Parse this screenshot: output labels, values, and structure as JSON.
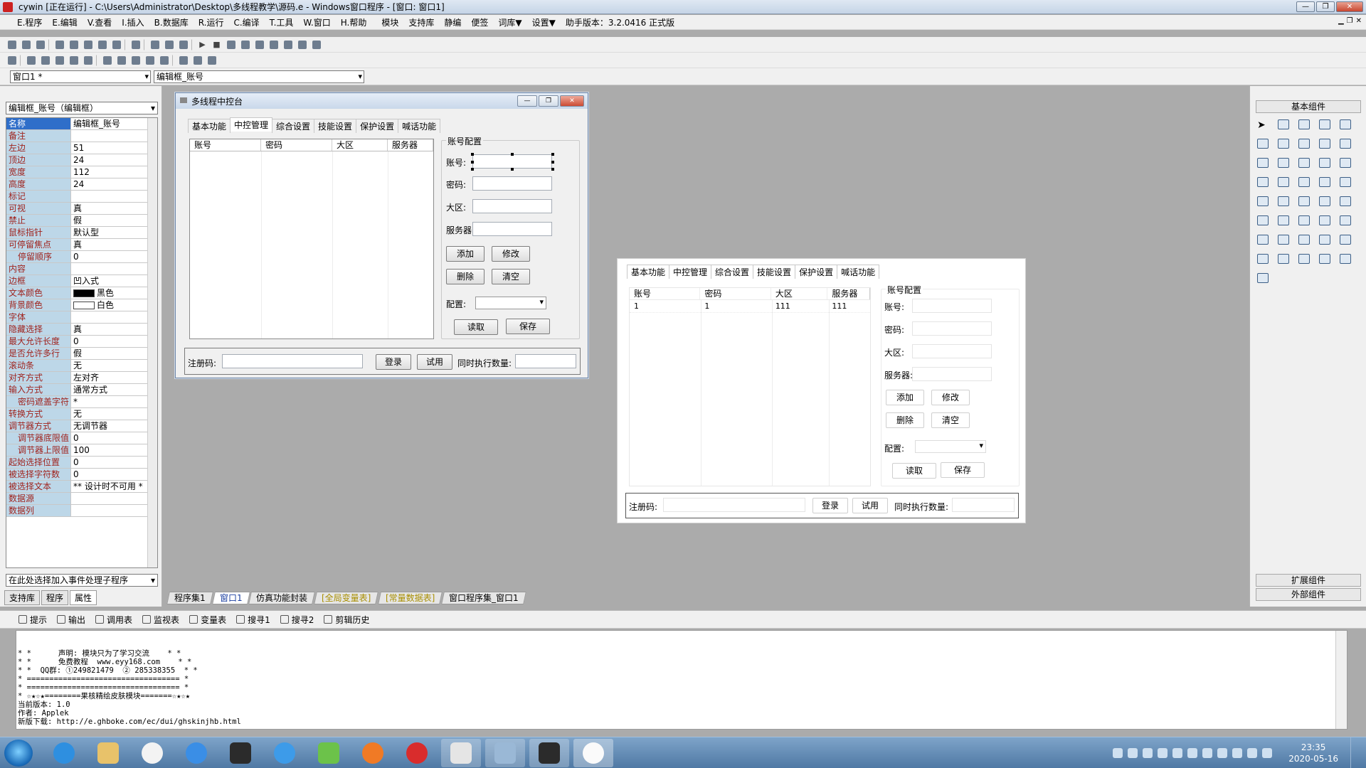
{
  "window": {
    "title": "cywin [正在运行] - C:\\Users\\Administrator\\Desktop\\多线程教学\\源码.e - Windows窗口程序 - [窗口: 窗口1]",
    "controls": [
      "—",
      "❐",
      "✕"
    ]
  },
  "menu": {
    "items": [
      "E.程序",
      "E.编辑",
      "V.查看",
      "I.插入",
      "B.数据库",
      "R.运行",
      "C.编译",
      "T.工具",
      "W.窗口",
      "H.帮助",
      "模块",
      "支持库",
      "静编",
      "便签",
      "词库▼",
      "设置▼"
    ],
    "version": "助手版本：3.2.0416 正式版"
  },
  "selectors": {
    "window_combo": "窗口1 *",
    "control_combo": "编辑框_账号"
  },
  "properties": {
    "object_combo": "编辑框_账号（编辑框）",
    "rows": [
      {
        "k": "名称",
        "v": "编辑框_账号",
        "sel": true
      },
      {
        "k": "备注",
        "v": ""
      },
      {
        "k": "左边",
        "v": "51"
      },
      {
        "k": "顶边",
        "v": "24"
      },
      {
        "k": "宽度",
        "v": "112"
      },
      {
        "k": "高度",
        "v": "24"
      },
      {
        "k": "标记",
        "v": ""
      },
      {
        "k": "可视",
        "v": "真"
      },
      {
        "k": "禁止",
        "v": "假"
      },
      {
        "k": "鼠标指针",
        "v": "默认型"
      },
      {
        "k": "可停留焦点",
        "v": "真"
      },
      {
        "k": "停留顺序",
        "v": "0",
        "sub": true
      },
      {
        "k": "内容",
        "v": ""
      },
      {
        "k": "边框",
        "v": "凹入式"
      },
      {
        "k": "文本颜色",
        "v": "黑色",
        "swatch": "#000000"
      },
      {
        "k": "背景颜色",
        "v": "白色",
        "swatch": "#ffffff"
      },
      {
        "k": "字体",
        "v": ""
      },
      {
        "k": "隐藏选择",
        "v": "真"
      },
      {
        "k": "最大允许长度",
        "v": "0"
      },
      {
        "k": "是否允许多行",
        "v": "假"
      },
      {
        "k": "滚动条",
        "v": "无"
      },
      {
        "k": "对齐方式",
        "v": "左对齐"
      },
      {
        "k": "输入方式",
        "v": "通常方式"
      },
      {
        "k": "密码遮盖字符",
        "v": "*",
        "sub": true
      },
      {
        "k": "转换方式",
        "v": "无"
      },
      {
        "k": "调节器方式",
        "v": "无调节器"
      },
      {
        "k": "调节器底限值",
        "v": "0",
        "sub": true
      },
      {
        "k": "调节器上限值",
        "v": "100",
        "sub": true
      },
      {
        "k": "起始选择位置",
        "v": "0"
      },
      {
        "k": "被选择字符数",
        "v": "0"
      },
      {
        "k": "被选择文本",
        "v": "** 设计时不可用 *"
      },
      {
        "k": "数据源",
        "v": ""
      },
      {
        "k": "数据列",
        "v": ""
      }
    ],
    "event_combo": "在此处选择加入事件处理子程序",
    "tabs": [
      "支持库",
      "程序",
      "属性"
    ]
  },
  "designer": {
    "title": "多线程中控台",
    "tabs": [
      "基本功能",
      "中控管理",
      "综合设置",
      "技能设置",
      "保护设置",
      "喊话功能"
    ],
    "columns": [
      "账号",
      "密码",
      "大区",
      "服务器"
    ],
    "group_title": "账号配置",
    "labels": {
      "account": "账号:",
      "password": "密码:",
      "region": "大区:",
      "server": "服务器:",
      "config": "配置:"
    },
    "buttons": {
      "add": "添加",
      "edit": "修改",
      "delete": "删除",
      "clear": "清空",
      "read": "读取",
      "save": "保存"
    },
    "footer": {
      "reg_label": "注册码:",
      "login": "登录",
      "trial": "试用",
      "concurrent_label": "同时执行数量:"
    }
  },
  "runtime": {
    "tabs": [
      "基本功能",
      "中控管理",
      "综合设置",
      "技能设置",
      "保护设置",
      "喊话功能"
    ],
    "columns": [
      "账号",
      "密码",
      "大区",
      "服务器"
    ],
    "rows": [
      [
        "1",
        "1",
        "111",
        "111"
      ]
    ],
    "group_title": "账号配置",
    "labels": {
      "account": "账号:",
      "password": "密码:",
      "region": "大区:",
      "server": "服务器:",
      "config": "配置:"
    },
    "buttons": {
      "add": "添加",
      "edit": "修改",
      "delete": "删除",
      "clear": "清空",
      "read": "读取",
      "save": "保存"
    },
    "footer": {
      "reg_label": "注册码:",
      "login": "登录",
      "trial": "试用",
      "concurrent_label": "同时执行数量:"
    }
  },
  "components": {
    "header": "基本组件",
    "ext": "扩展组件",
    "outer": "外部组件"
  },
  "doc_tabs": [
    "程序集1",
    "窗口1",
    "仿真功能封装",
    "[全局变量表]",
    "[常量数据表]",
    "窗口程序集_窗口1"
  ],
  "output_tabs": [
    "提示",
    "输出",
    "调用表",
    "监视表",
    "变量表",
    "搜寻1",
    "搜寻2",
    "剪辑历史"
  ],
  "output_text": "* *      声明: 模块只为了学习交流    * *\n* *      免费教程  www.eyy168.com    * *\n* *  QQ群: ①249821479  ② 285338355  * *\n* ================================== *\n* ================================== *\n* ☆★☆★========果核精绘皮肤模块=======☆★☆★\n当前版本: 1.0\n作者: Applek\n新版下载: http://e.ghboke.com/ec/dui/ghskinjhb.html\n☆★☆★==============================☆★☆★",
  "taskbar": {
    "time": "23:35",
    "date": "2020-05-16"
  }
}
